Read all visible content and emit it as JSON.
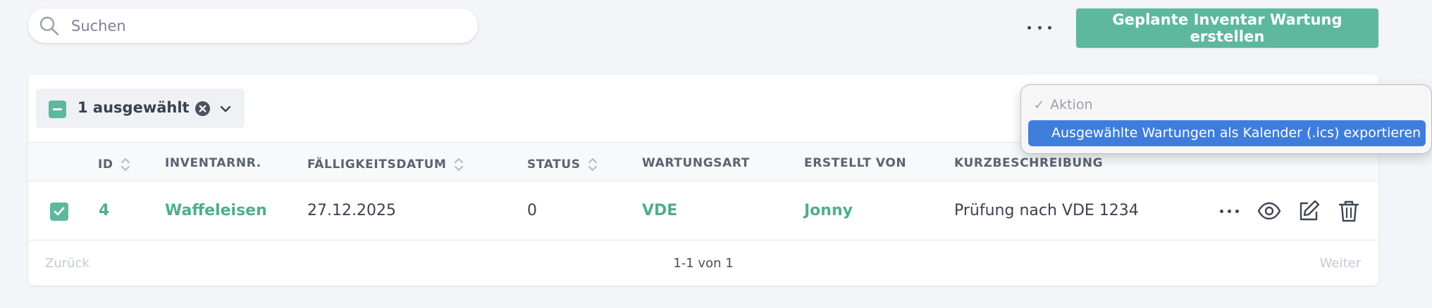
{
  "search": {
    "placeholder": "Suchen"
  },
  "header": {
    "create_button": "Geplante Inventar Wartung erstellen"
  },
  "selection": {
    "label": "1 ausgewählt"
  },
  "table": {
    "columns": [
      "ID",
      "INVENTARNR.",
      "FÄLLIGKEITSDATUM",
      "STATUS",
      "WARTUNGSART",
      "ERSTELLT VON",
      "KURZBESCHREIBUNG"
    ],
    "rows": [
      {
        "id": "4",
        "inventarnr": "Waffeleisen",
        "faelligkeitsdatum": "27.12.2025",
        "status": "0",
        "wartungsart": "VDE",
        "erstellt_von": "Jonny",
        "kurzbeschreibung": "Prüfung nach VDE 1234"
      }
    ]
  },
  "pagination": {
    "prev": "Zurück",
    "summary": "1-1 von 1",
    "next": "Weiter"
  },
  "dropdown": {
    "header": "Aktion",
    "options": [
      "Ausgewählte Wartungen als Kalender (.ics) exportieren"
    ]
  },
  "colors": {
    "accent": "#5eb89e",
    "link": "#4fae8f",
    "highlight": "#3f7ddc"
  },
  "icons": [
    "search-icon",
    "more-icon",
    "clear-icon",
    "chevron-down-icon",
    "sort-icon",
    "check-icon",
    "eye-icon",
    "edit-icon",
    "trash-icon"
  ]
}
